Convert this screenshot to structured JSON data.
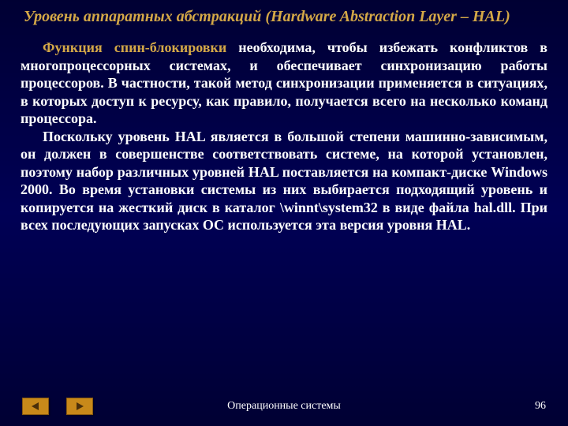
{
  "title": "Уровень аппаратных абстракций (Hardware Abstraction Layer – HAL)",
  "paragraphs": {
    "p1_highlight": "Функция спин-блокировки",
    "p1_rest": " необходима, чтобы избежать конфликтов в многопроцессорных системах, и обеспечивает синхронизацию работы процессоров. В частности, такой метод синхронизации применяется в ситуациях, в которых доступ к ресурсу, как правило, получается всего на несколько команд процессора.",
    "p2": "Поскольку уровень HAL является в большой степени машинно-зависимым, он должен в совершенстве соответствовать системе, на которой установлен, поэтому набор различных уровней HAL поставляется на компакт-диске Windows 2000. Во время установки системы из них выбирается подходящий уровень и копируется на жесткий диск в каталог \\winnt\\system32 в виде файла hal.dll. При всех последующих запусках ОС используется эта версия уровня HAL."
  },
  "footer": {
    "text": "Операционные системы",
    "page_number": "96"
  }
}
